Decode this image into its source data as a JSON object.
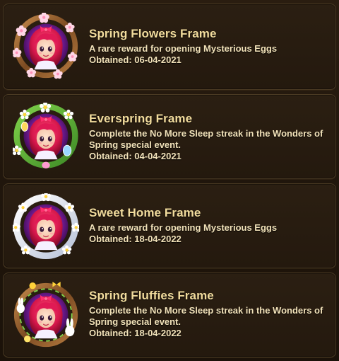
{
  "frames": [
    {
      "title": "Spring Flowers Frame",
      "description": "A rare reward for opening Mysterious Eggs",
      "obtained": "Obtained: 06-04-2021",
      "icon": "spring-flowers-frame-icon"
    },
    {
      "title": "Everspring Frame",
      "description": "Complete the No More Sleep streak in the Wonders of Spring special event.",
      "obtained": "Obtained: 04-04-2021",
      "icon": "everspring-frame-icon"
    },
    {
      "title": "Sweet Home Frame",
      "description": "A rare reward for opening Mysterious Eggs",
      "obtained": "Obtained: 18-04-2022",
      "icon": "sweet-home-frame-icon"
    },
    {
      "title": "Spring Fluffies Frame",
      "description": "Complete the No More Sleep streak in the Wonders of Spring special event.",
      "obtained": "Obtained: 18-04-2022",
      "icon": "spring-fluffies-frame-icon"
    }
  ],
  "colors": {
    "title": "#f2dc9d",
    "text": "#f2e2b9",
    "card_bg": "#2b1f12",
    "card_border": "#4a3a23"
  }
}
